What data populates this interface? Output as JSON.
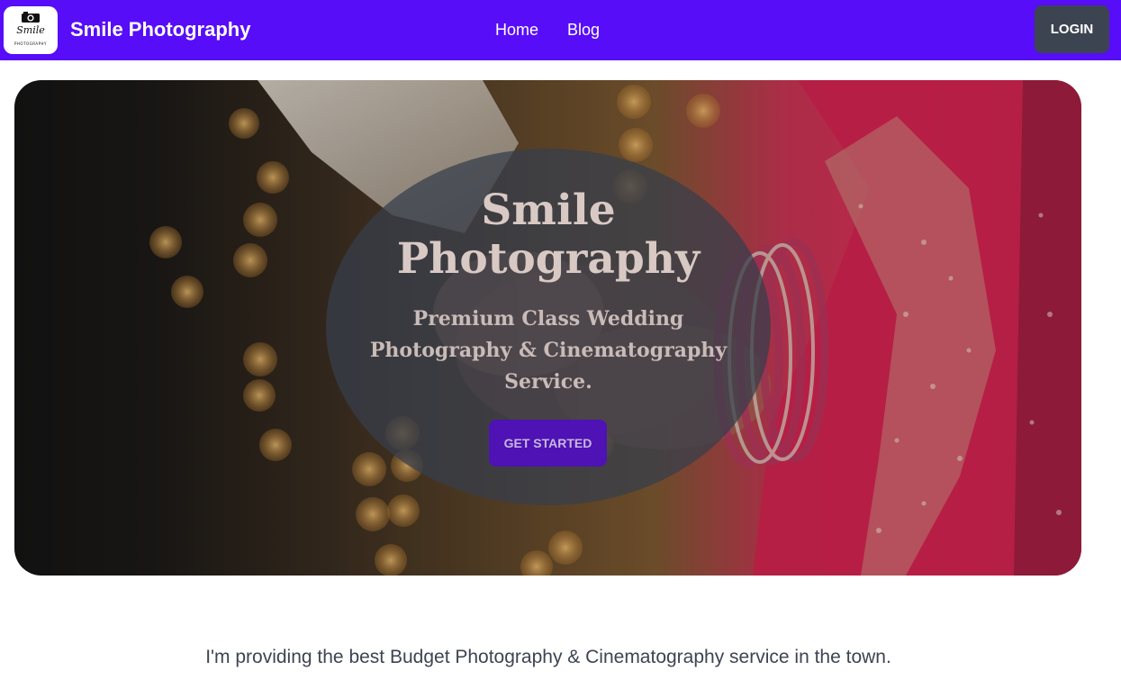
{
  "navbar": {
    "logo": {
      "icon": "camera-icon",
      "script_text": "Smile",
      "sub_text": "PHOTOGRAPHY"
    },
    "brand_title": "Smile Photography",
    "links": [
      {
        "label": "Home"
      },
      {
        "label": "Blog"
      }
    ],
    "login_label": "LOGIN",
    "colors": {
      "background": "#570df8",
      "login_button": "#3d4451"
    }
  },
  "hero": {
    "title_line1": "Smile",
    "title_line2": "Photography",
    "description": "Premium Class Wedding Photography & Cinematography Service.",
    "cta_label": "GET STARTED",
    "background_image": "wedding-hands-photo"
  },
  "intro": {
    "tagline": "I'm providing the best Budget Photography & Cinematography service in the town."
  }
}
